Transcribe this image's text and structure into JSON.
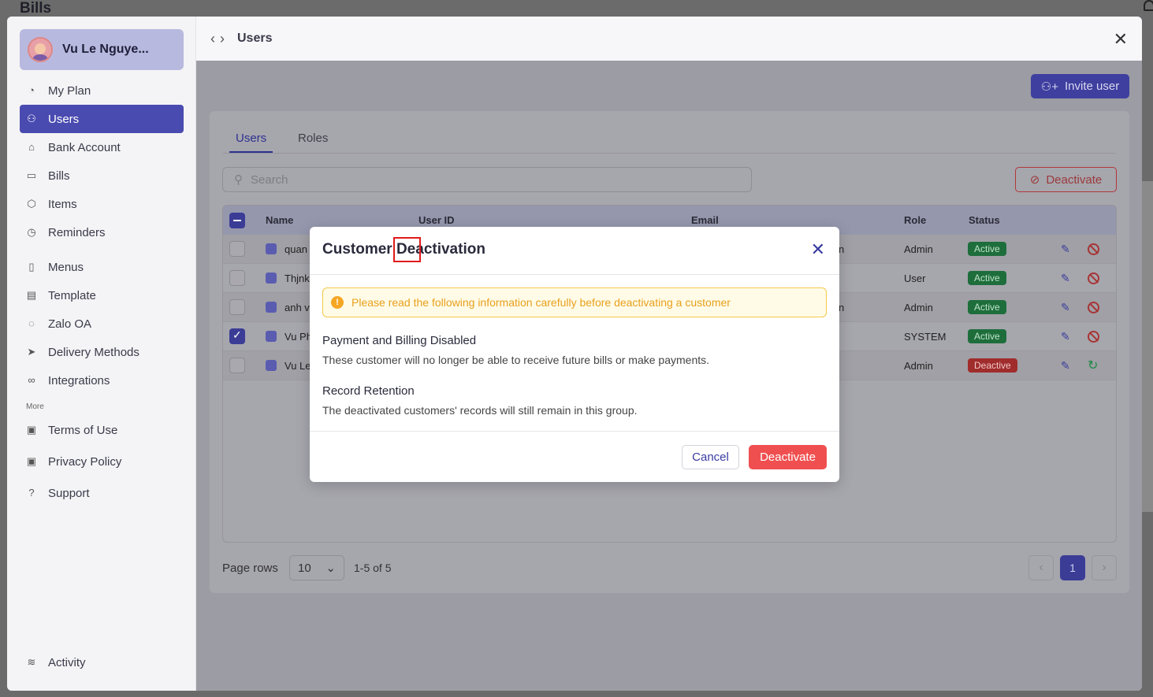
{
  "app": {
    "title": "Bills"
  },
  "profile": {
    "name": "Vu Le Nguye..."
  },
  "sidebar": {
    "items": [
      {
        "label": "My Plan",
        "icon": "pie-chart-icon"
      },
      {
        "label": "Users",
        "icon": "users-icon",
        "active": true
      },
      {
        "label": "Bank Account",
        "icon": "bank-icon"
      },
      {
        "label": "Bills",
        "icon": "bill-icon"
      },
      {
        "label": "Items",
        "icon": "box-icon"
      },
      {
        "label": "Reminders",
        "icon": "alarm-icon"
      },
      {
        "label": "Menus",
        "icon": "menu-icon"
      },
      {
        "label": "Template",
        "icon": "template-icon"
      },
      {
        "label": "Zalo OA",
        "icon": "chat-icon"
      },
      {
        "label": "Delivery Methods",
        "icon": "send-icon"
      },
      {
        "label": "Integrations",
        "icon": "link-icon"
      }
    ],
    "more_label": "More",
    "more_items": [
      {
        "label": "Terms of Use",
        "icon": "clipboard-icon"
      },
      {
        "label": "Privacy Policy",
        "icon": "clipboard-icon"
      },
      {
        "label": "Support",
        "icon": "help-icon"
      }
    ],
    "footer_item": {
      "label": "Activity",
      "icon": "layers-icon"
    }
  },
  "header": {
    "title": "Users"
  },
  "toolbar": {
    "invite_label": "Invite user",
    "deactivate_label": "Deactivate"
  },
  "tabs": [
    {
      "label": "Users"
    },
    {
      "label": "Roles"
    }
  ],
  "search": {
    "placeholder": "Search"
  },
  "table": {
    "columns": [
      "Name",
      "User ID",
      "Email",
      "Role",
      "Status"
    ],
    "rows": [
      {
        "name": "quan",
        "email_suffix": "n",
        "role": "Admin",
        "status": "Active",
        "checked": false
      },
      {
        "name": "Thjnk",
        "email_suffix": "",
        "role": "User",
        "status": "Active",
        "checked": false
      },
      {
        "name": "anh v",
        "email_suffix": "n",
        "role": "Admin",
        "status": "Active",
        "checked": false
      },
      {
        "name": "Vu Ph",
        "email_suffix": "",
        "role": "SYSTEM",
        "status": "Active",
        "checked": true
      },
      {
        "name": "Vu Le",
        "email_suffix": "",
        "role": "Admin",
        "status": "Deactive",
        "checked": false
      }
    ]
  },
  "pagination": {
    "label": "Page rows",
    "rows_value": "10",
    "range": "1-5 of 5",
    "current_page": "1"
  },
  "modal": {
    "title": "Customer Deactivation",
    "warning": "Please read the following information carefully before deactivating a customer",
    "sections": [
      {
        "title": "Payment and Billing Disabled",
        "text": "These customer will no longer be able to receive future bills or make payments."
      },
      {
        "title": "Record Retention",
        "text": "The deactivated customers' records will still remain in this group."
      }
    ],
    "cancel_label": "Cancel",
    "confirm_label": "Deactivate"
  },
  "colors": {
    "accent": "#4a4bb0",
    "danger": "#f04f50",
    "success": "#1e6e3c",
    "warning": "#f5a623"
  }
}
